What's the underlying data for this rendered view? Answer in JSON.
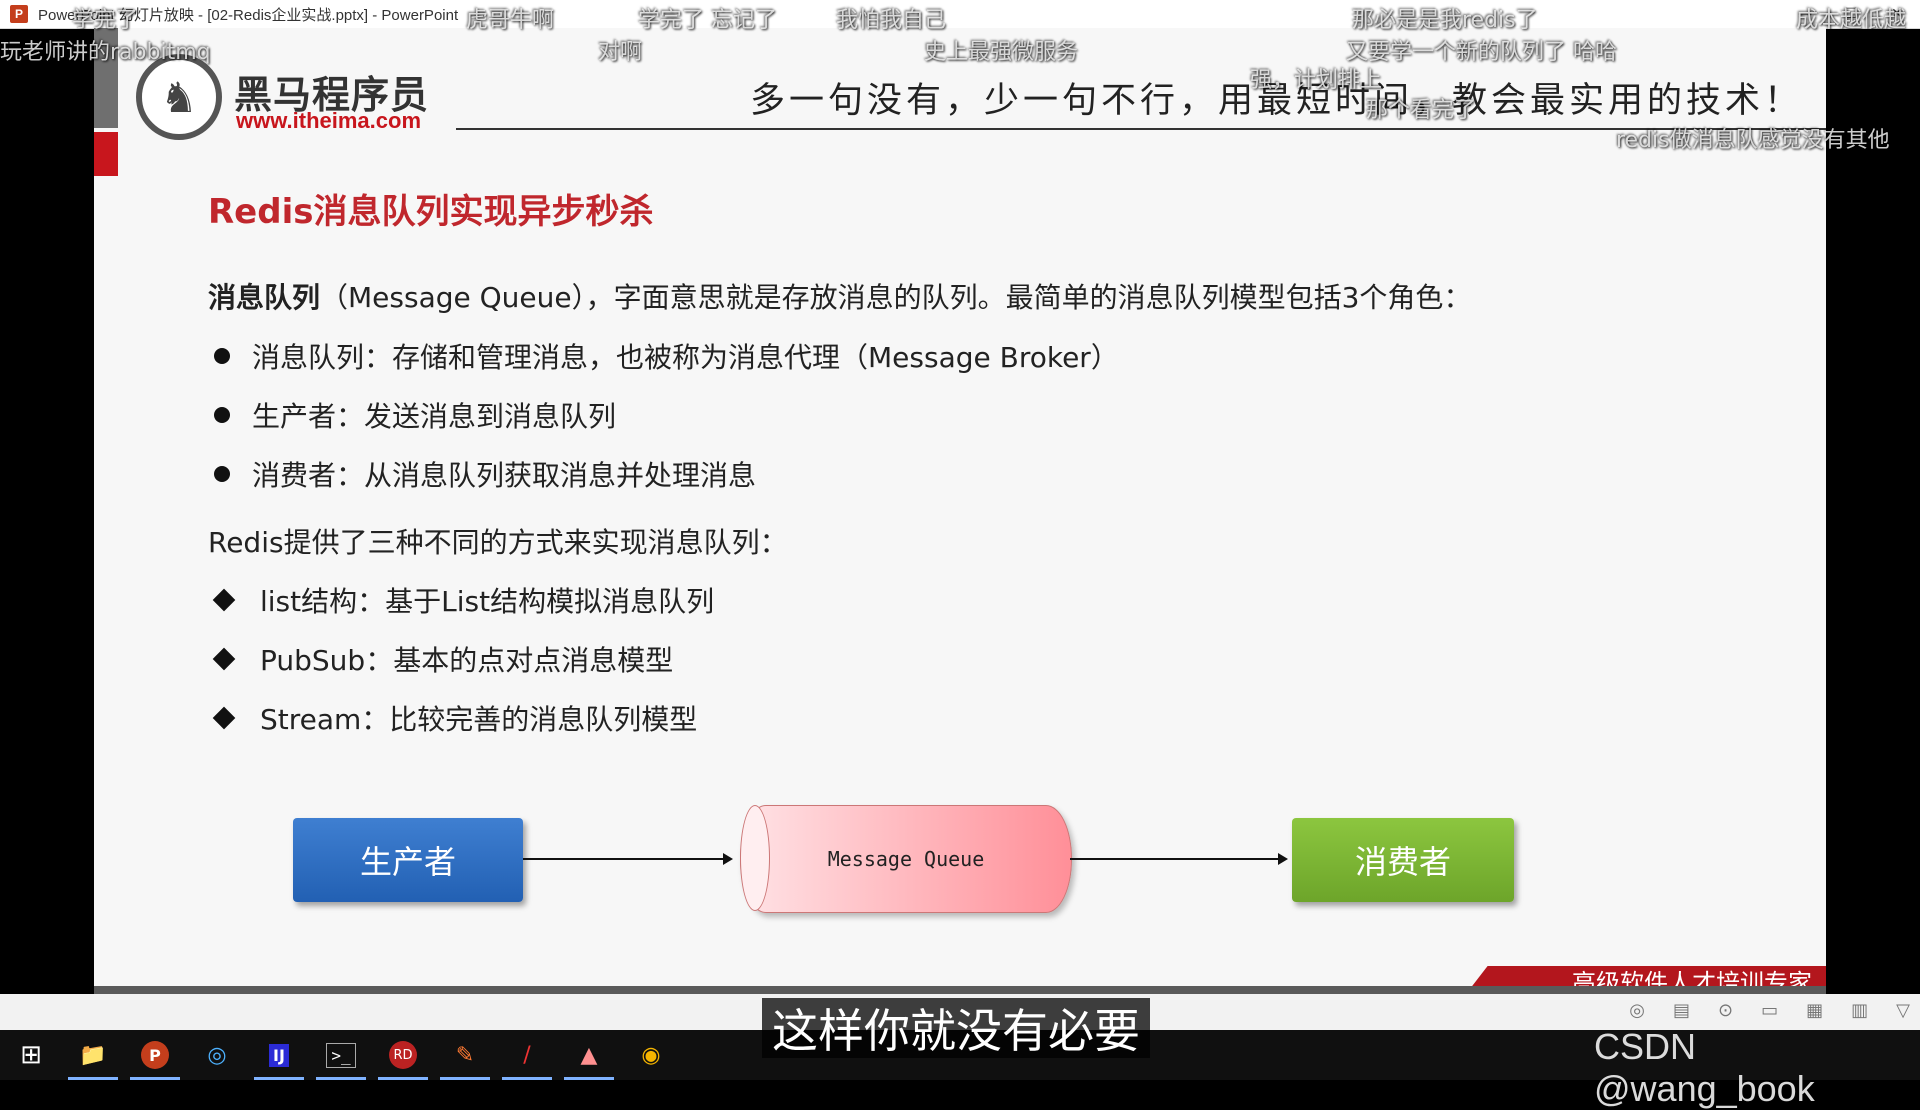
{
  "window": {
    "title": "PowerPoint 幻灯片放映 - [02-Redis企业实战.pptx] - PowerPoint",
    "app_icon_label": "P",
    "minimize": "—",
    "maximize": "☐",
    "close": "✕"
  },
  "slide": {
    "logo": {
      "name": "黑马程序员",
      "url": "www.itheima.com",
      "horse": "♞"
    },
    "slogan": "多一句没有，少一句不行，用最短时间，教会最实用的技术！",
    "title": "Redis消息队列实现异步秒杀",
    "intro_bold": "消息队列",
    "intro_rest": "（Message Queue），字面意思就是存放消息的队列。最简单的消息队列模型包括3个角色：",
    "roles": [
      "消息队列：存储和管理消息，也被称为消息代理（Message Broker）",
      "生产者：发送消息到消息队列",
      "消费者：从消息队列获取消息并处理消息"
    ],
    "para2": "Redis提供了三种不同的方式来实现消息队列：",
    "methods": [
      "list结构：基于List结构模拟消息队列",
      "PubSub：基本的点对点消息模型",
      "Stream：比较完善的消息队列模型"
    ],
    "diagram": {
      "producer": "生产者",
      "queue": "Message Queue",
      "consumer": "消费者"
    },
    "footer_slogan": "高级软件人才培训专家"
  },
  "overlay": {
    "subtitle": "这样你就没有必要",
    "watermark": "CSDN @wang_book",
    "danmaku": [
      "学完了",
      "玩老师讲的rabbitmq",
      "虎哥牛啊",
      "学完了  忘记了",
      "对啊",
      "我怕我自己",
      "史上最强微服务",
      "那必是是我redis了",
      "又要学一个新的队列了  哈哈",
      "成本越低越",
      "强，计划排上",
      "那个看完了",
      "redis做消息队感觉没有其他"
    ]
  },
  "taskbar": {
    "start": "⊞",
    "apps": [
      "📁",
      "P",
      "◎",
      "IJ",
      ">_",
      "RD",
      "✎",
      "/",
      "▲",
      "◉"
    ]
  }
}
